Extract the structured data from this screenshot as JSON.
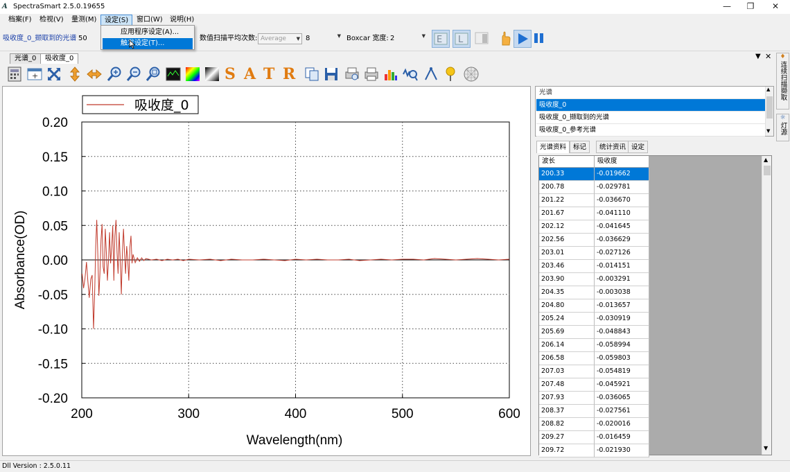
{
  "window": {
    "title": "SpectraSmart 2.5.0.19655",
    "minimize": "—",
    "maximize": "❐",
    "close": "✕"
  },
  "menu": [
    "档案(F)",
    "检视(V)",
    "量测(M)",
    "设定(S)",
    "窗口(W)",
    "说明(H)"
  ],
  "dropdown": {
    "items": [
      "应用程序设定(A)...",
      "触发设定(T)..."
    ],
    "selected_index": 1
  },
  "toolbar": {
    "source_label": "吸收度_0_撷取到的光谱",
    "source_value": "50",
    "avg_label": "数值扫描平均次数:",
    "avg_mode": "Average",
    "avg_count": "8",
    "boxcar_label": "Boxcar 宽度:",
    "boxcar_value": "2"
  },
  "doc_tabs": [
    "光谱_0",
    "吸收度_0"
  ],
  "chart_data": {
    "type": "line",
    "legend": "吸收度_0",
    "xlabel": "Wavelength(nm)",
    "ylabel": "Absorbance(OD)",
    "xlim": [
      200,
      600
    ],
    "ylim": [
      -0.2,
      0.2
    ],
    "xticks": [
      200,
      300,
      400,
      500,
      600
    ],
    "yticks": [
      "0.20",
      "0.15",
      "0.10",
      "0.05",
      "0.00",
      "-0.05",
      "-0.10",
      "-0.15",
      "-0.20"
    ],
    "color": "#c0392b",
    "series": [
      {
        "x": [
          200.3,
          201.7,
          203.0,
          204.4,
          205.7,
          207.0,
          208.4,
          209.7,
          211.0,
          212.2,
          213.0,
          214.0,
          215.0,
          216.0,
          217.0,
          218.0,
          219.0,
          220.0,
          221.0,
          222.0,
          223.0,
          224.0,
          225.0,
          226.0,
          227.0,
          228.0,
          229.0,
          230.0,
          231.0,
          232.0,
          233.0,
          234.0,
          235.0,
          236.0,
          237.0,
          238.0,
          239.0,
          240.0,
          241.0,
          242.0,
          243.0,
          244.0,
          245.0,
          246.0,
          247.0,
          248.0,
          249.0,
          250.0,
          252.0,
          254.0,
          256.0,
          258.0,
          260.0,
          265.0,
          270.0,
          275.0,
          280.0,
          285.0,
          290.0,
          295.0,
          300.0,
          310.0,
          320.0,
          330.0,
          340.0,
          350.0,
          360.0,
          370.0,
          380.0,
          390.0,
          400.0,
          410.0,
          420.0,
          430.0,
          440.0,
          450.0,
          460.0,
          470.0,
          480.0,
          490.0,
          500.0,
          510.0,
          520.0,
          530.0,
          540.0,
          550.0,
          560.0,
          570.0,
          580.0,
          590.0,
          600.0
        ],
        "y": [
          -0.02,
          -0.041,
          -0.027,
          -0.003,
          -0.031,
          -0.055,
          -0.028,
          -0.022,
          -0.1,
          -0.04,
          0.02,
          0.058,
          0.01,
          -0.052,
          -0.02,
          0.03,
          0.052,
          -0.01,
          -0.02,
          0.045,
          0.01,
          -0.03,
          0.0,
          0.04,
          -0.005,
          0.02,
          0.05,
          -0.03,
          0.035,
          0.058,
          0.01,
          -0.02,
          0.04,
          0.0,
          -0.05,
          0.01,
          0.045,
          0.01,
          -0.02,
          0.02,
          0.0,
          -0.03,
          0.018,
          0.035,
          -0.005,
          0.008,
          0.002,
          -0.004,
          0.003,
          -0.002,
          0.003,
          -0.001,
          0.002,
          0.0,
          0.001,
          -0.001,
          0.001,
          0.0,
          0.001,
          -0.001,
          0.001,
          0.0,
          0.001,
          -0.001,
          0.001,
          0.0,
          0.0,
          0.001,
          0.0,
          -0.001,
          0.001,
          0.0,
          0.001,
          0.0,
          0.0,
          0.001,
          -0.001,
          0.0,
          0.001,
          0.0,
          0.001,
          0.001,
          0.0,
          0.002,
          0.001,
          0.0,
          0.001,
          0.002,
          0.001,
          0.0,
          0.001
        ]
      }
    ]
  },
  "series_list": {
    "header": "光谱",
    "items": [
      "吸收度_0",
      "吸收度_0_撷取到的光谱",
      "吸收度_0_参考光谱"
    ],
    "selected_index": 0
  },
  "right_tabs": [
    "光谱资料",
    "标记",
    "统计资讯",
    "设定"
  ],
  "data_table": {
    "columns": [
      "波长",
      "吸收度"
    ],
    "rows": [
      [
        "200.33",
        "-0.019662"
      ],
      [
        "200.78",
        "-0.029781"
      ],
      [
        "201.22",
        "-0.036670"
      ],
      [
        "201.67",
        "-0.041110"
      ],
      [
        "202.12",
        "-0.041645"
      ],
      [
        "202.56",
        "-0.036629"
      ],
      [
        "203.01",
        "-0.027126"
      ],
      [
        "203.46",
        "-0.014151"
      ],
      [
        "203.90",
        "-0.003291"
      ],
      [
        "204.35",
        "-0.003038"
      ],
      [
        "204.80",
        "-0.013657"
      ],
      [
        "205.24",
        "-0.030919"
      ],
      [
        "205.69",
        "-0.048843"
      ],
      [
        "206.14",
        "-0.058994"
      ],
      [
        "206.58",
        "-0.059803"
      ],
      [
        "207.03",
        "-0.054819"
      ],
      [
        "207.48",
        "-0.045921"
      ],
      [
        "207.93",
        "-0.036065"
      ],
      [
        "208.37",
        "-0.027561"
      ],
      [
        "208.82",
        "-0.020016"
      ],
      [
        "209.27",
        "-0.016459"
      ],
      [
        "209.72",
        "-0.021930"
      ]
    ],
    "selected_index": 0
  },
  "side_dock": [
    "连续扫描撷取",
    "灯源"
  ],
  "status": "Dll Version : 2.5.0.11"
}
